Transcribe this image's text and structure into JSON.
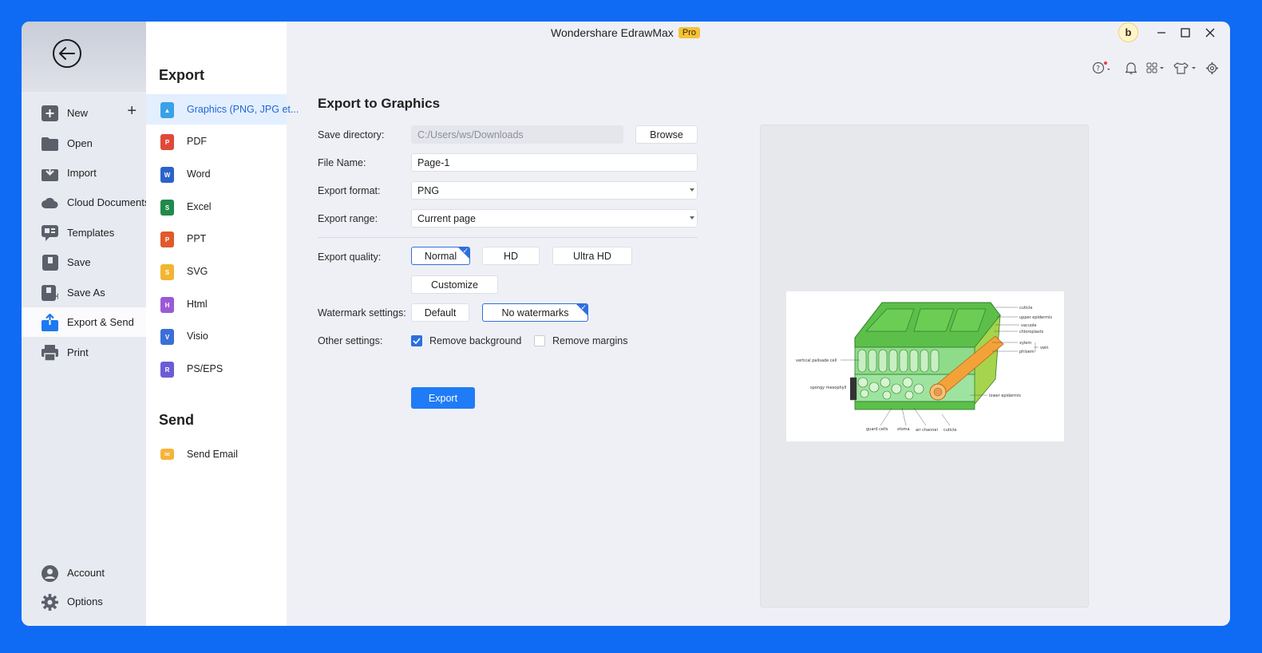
{
  "titlebar": {
    "app_name": "Wondershare EdrawMax",
    "badge": "Pro",
    "avatar_letter": "b"
  },
  "leftnav": {
    "items": [
      {
        "label": "New",
        "icon": "new-plus-icon"
      },
      {
        "label": "Open",
        "icon": "folder-icon"
      },
      {
        "label": "Import",
        "icon": "import-icon"
      },
      {
        "label": "Cloud Documents",
        "icon": "cloud-icon"
      },
      {
        "label": "Templates",
        "icon": "templates-icon"
      },
      {
        "label": "Save",
        "icon": "save-icon"
      },
      {
        "label": "Save As",
        "icon": "save-as-icon"
      },
      {
        "label": "Export & Send",
        "icon": "export-icon",
        "active": true
      },
      {
        "label": "Print",
        "icon": "print-icon"
      }
    ],
    "bottom": [
      {
        "label": "Account",
        "icon": "account-icon"
      },
      {
        "label": "Options",
        "icon": "gear-icon"
      }
    ]
  },
  "middle": {
    "export_heading": "Export",
    "export_items": [
      {
        "label": "Graphics (PNG, JPG et...",
        "color": "#3aa0e8"
      },
      {
        "label": "PDF",
        "color": "#e0493a"
      },
      {
        "label": "Word",
        "color": "#2b63c9"
      },
      {
        "label": "Excel",
        "color": "#1f8a4c"
      },
      {
        "label": "PPT",
        "color": "#e05a2b"
      },
      {
        "label": "SVG",
        "color": "#f2b532"
      },
      {
        "label": "Html",
        "color": "#9b59d6"
      },
      {
        "label": "Visio",
        "color": "#3a6fd8"
      },
      {
        "label": "PS/EPS",
        "color": "#6b5cd6"
      }
    ],
    "send_heading": "Send",
    "send_items": [
      {
        "label": "Send Email",
        "color": "#f5b43a"
      }
    ]
  },
  "form": {
    "title": "Export to Graphics",
    "save_directory_label": "Save directory:",
    "save_directory_value": "C:/Users/ws/Downloads",
    "browse_label": "Browse",
    "file_name_label": "File Name:",
    "file_name_value": "Page-1",
    "export_format_label": "Export format:",
    "export_format_value": "PNG",
    "export_range_label": "Export range:",
    "export_range_value": "Current page",
    "export_quality_label": "Export quality:",
    "quality_options": [
      "Normal",
      "HD",
      "Ultra HD"
    ],
    "quality_selected": "Normal",
    "customize_label": "Customize",
    "watermark_label": "Watermark settings:",
    "watermark_options": [
      "Default",
      "No watermarks"
    ],
    "watermark_selected": "No watermarks",
    "other_settings_label": "Other settings:",
    "remove_background_label": "Remove background",
    "remove_background_checked": true,
    "remove_margins_label": "Remove margins",
    "remove_margins_checked": false,
    "export_button": "Export"
  },
  "preview": {
    "labels": {
      "cuticle": "cuticle",
      "upper_epidermis": "upper epidermis",
      "vacuole": "vacuole",
      "chloroplasts": "chloroplasts",
      "xylem": "xylem",
      "phloem": "phloem",
      "vein": "vein",
      "vertical_palisade_cell": "vertical palisade cell",
      "spongy_mesophyll": "spongy mesophyll",
      "lower_epidermis": "lower epidermis",
      "guard_cells": "guard cells",
      "stoma": "stoma",
      "air_channel": "air channel",
      "cuticle_bottom": "cuticle"
    }
  }
}
